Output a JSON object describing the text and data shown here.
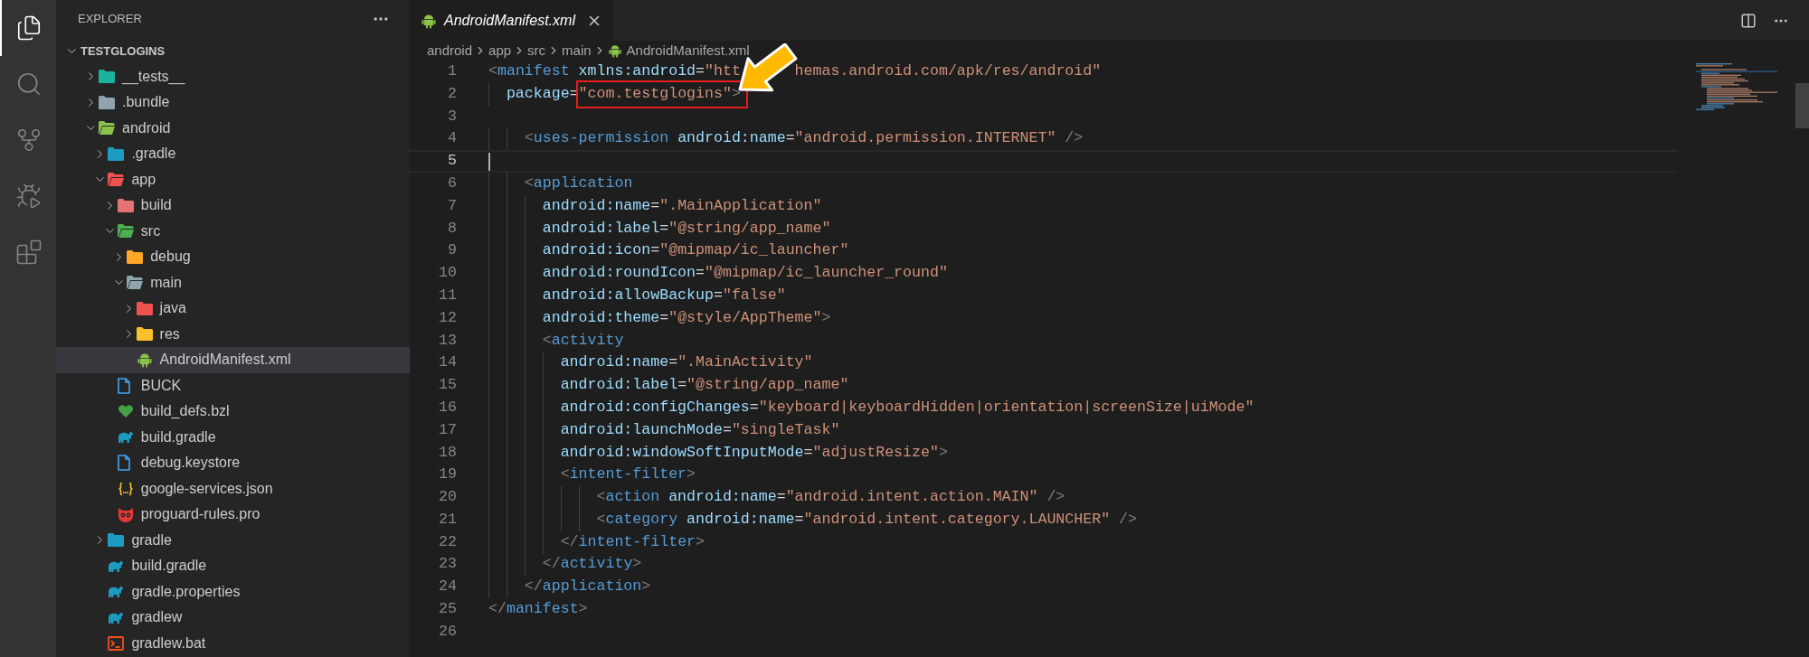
{
  "activity_bar": [
    {
      "kind": "files",
      "selected": true
    },
    {
      "kind": "search",
      "selected": false
    },
    {
      "kind": "source-control",
      "selected": false
    },
    {
      "kind": "run-debug",
      "selected": false
    },
    {
      "kind": "extensions",
      "selected": false
    }
  ],
  "explorer": {
    "title": "EXPLORER",
    "root": {
      "name": "TESTGLOGINS",
      "expanded": true,
      "children": [
        {
          "name": "__tests__",
          "kind": "folder-tests",
          "expanded": false,
          "selected": false
        },
        {
          "name": ".bundle",
          "kind": "folder",
          "expanded": false,
          "selected": false
        },
        {
          "name": "android",
          "kind": "folder-android",
          "expanded": true,
          "selected": false,
          "children": [
            {
              "name": ".gradle",
              "kind": "folder-gradle",
              "expanded": false,
              "selected": false
            },
            {
              "name": "app",
              "kind": "folder-app",
              "expanded": true,
              "selected": false,
              "children": [
                {
                  "name": "build",
                  "kind": "folder-build",
                  "expanded": false,
                  "selected": false
                },
                {
                  "name": "src",
                  "kind": "folder-src",
                  "expanded": true,
                  "selected": false,
                  "children": [
                    {
                      "name": "debug",
                      "kind": "folder-debug",
                      "expanded": false,
                      "selected": false
                    },
                    {
                      "name": "main",
                      "kind": "folder",
                      "expanded": true,
                      "selected": false,
                      "children": [
                        {
                          "name": "java",
                          "kind": "folder-java",
                          "expanded": false,
                          "selected": false
                        },
                        {
                          "name": "res",
                          "kind": "folder-res",
                          "expanded": false,
                          "selected": false
                        },
                        {
                          "name": "AndroidManifest.xml",
                          "kind": "android",
                          "selected": true
                        }
                      ]
                    }
                  ]
                },
                {
                  "name": "BUCK",
                  "kind": "file",
                  "selected": false
                },
                {
                  "name": "build_defs.bzl",
                  "kind": "heart",
                  "selected": false
                },
                {
                  "name": "build.gradle",
                  "kind": "elephant",
                  "selected": false
                },
                {
                  "name": "debug.keystore",
                  "kind": "file",
                  "selected": false
                },
                {
                  "name": "google-services.json",
                  "kind": "json",
                  "selected": false
                },
                {
                  "name": "proguard-rules.pro",
                  "kind": "owl",
                  "selected": false
                }
              ]
            },
            {
              "name": "gradle",
              "kind": "folder-gradle",
              "expanded": false,
              "selected": false
            },
            {
              "name": "build.gradle",
              "kind": "elephant",
              "selected": false
            },
            {
              "name": "gradle.properties",
              "kind": "elephant",
              "selected": false
            },
            {
              "name": "gradlew",
              "kind": "elephant",
              "selected": false
            },
            {
              "name": "gradlew.bat",
              "kind": "terminal",
              "selected": false
            }
          ]
        }
      ]
    }
  },
  "tabs": [
    {
      "label": "AndroidManifest.xml",
      "selected": true,
      "preview": true
    }
  ],
  "breadcrumbs": [
    {
      "label": "android",
      "kind": "folder"
    },
    {
      "label": "app",
      "kind": "folder"
    },
    {
      "label": "src",
      "kind": "folder"
    },
    {
      "label": "main",
      "kind": "folder"
    },
    {
      "label": "AndroidManifest.xml",
      "kind": "android"
    }
  ],
  "code": {
    "lines": [
      {
        "number": "1",
        "current": false,
        "parts": [
          {
            "boxed": false,
            "tokens": [
              {
                "kind": "bracket",
                "text": "<"
              },
              {
                "kind": "tag",
                "text": "manifest"
              },
              {
                "kind": "attr",
                "text": " xmlns:android"
              },
              {
                "kind": "plain",
                "text": "="
              },
              {
                "kind": "string",
                "text": "\"htt"
              }
            ]
          },
          {
            "boxed": false,
            "tokens": [
              {
                "kind": "string",
                "text": "hemas.android.com/apk/res/android\""
              }
            ]
          }
        ]
      },
      {
        "number": "2",
        "current": false,
        "parts": [
          {
            "boxed": false,
            "tokens": [
              {
                "kind": "attr",
                "text": "  package"
              },
              {
                "kind": "plain",
                "text": "="
              }
            ]
          },
          {
            "boxed": true,
            "tokens": [
              {
                "kind": "string",
                "text": "\"com.testglogins\""
              },
              {
                "kind": "bracket",
                "text": ">"
              }
            ]
          }
        ]
      },
      {
        "number": "3",
        "current": false
      },
      {
        "number": "4",
        "current": false,
        "parts": [
          {
            "boxed": false,
            "tokens": [
              {
                "kind": "bracket",
                "text": "    <"
              },
              {
                "kind": "tag",
                "text": "uses-permission"
              },
              {
                "kind": "attr",
                "text": " android:name"
              },
              {
                "kind": "plain",
                "text": "="
              },
              {
                "kind": "string",
                "text": "\"android.permission.INTERNET\""
              },
              {
                "kind": "bracket",
                "text": " />"
              }
            ]
          }
        ]
      },
      {
        "number": "5",
        "current": true
      },
      {
        "number": "6",
        "current": false,
        "parts": [
          {
            "boxed": false,
            "tokens": [
              {
                "kind": "bracket",
                "text": "    <"
              },
              {
                "kind": "tag",
                "text": "application"
              }
            ]
          }
        ]
      },
      {
        "number": "7",
        "current": false,
        "parts": [
          {
            "boxed": false,
            "tokens": [
              {
                "kind": "attr",
                "text": "      android:name"
              },
              {
                "kind": "plain",
                "text": "="
              },
              {
                "kind": "string",
                "text": "\".MainApplication\""
              }
            ]
          }
        ]
      },
      {
        "number": "8",
        "current": false,
        "parts": [
          {
            "boxed": false,
            "tokens": [
              {
                "kind": "attr",
                "text": "      android:label"
              },
              {
                "kind": "plain",
                "text": "="
              },
              {
                "kind": "string",
                "text": "\"@string/app_name\""
              }
            ]
          }
        ]
      },
      {
        "number": "9",
        "current": false,
        "parts": [
          {
            "boxed": false,
            "tokens": [
              {
                "kind": "attr",
                "text": "      android:icon"
              },
              {
                "kind": "plain",
                "text": "="
              },
              {
                "kind": "string",
                "text": "\"@mipmap/ic_launcher\""
              }
            ]
          }
        ]
      },
      {
        "number": "10",
        "current": false,
        "parts": [
          {
            "boxed": false,
            "tokens": [
              {
                "kind": "attr",
                "text": "      android:roundIcon"
              },
              {
                "kind": "plain",
                "text": "="
              },
              {
                "kind": "string",
                "text": "\"@mipmap/ic_launcher_round\""
              }
            ]
          }
        ]
      },
      {
        "number": "11",
        "current": false,
        "parts": [
          {
            "boxed": false,
            "tokens": [
              {
                "kind": "attr",
                "text": "      android:allowBackup"
              },
              {
                "kind": "plain",
                "text": "="
              },
              {
                "kind": "string",
                "text": "\"false\""
              }
            ]
          }
        ]
      },
      {
        "number": "12",
        "current": false,
        "parts": [
          {
            "boxed": false,
            "tokens": [
              {
                "kind": "attr",
                "text": "      android:theme"
              },
              {
                "kind": "plain",
                "text": "="
              },
              {
                "kind": "string",
                "text": "\"@style/AppTheme\""
              },
              {
                "kind": "bracket",
                "text": ">"
              }
            ]
          }
        ]
      },
      {
        "number": "13",
        "current": false,
        "parts": [
          {
            "boxed": false,
            "tokens": [
              {
                "kind": "bracket",
                "text": "      <"
              },
              {
                "kind": "tag",
                "text": "activity"
              }
            ]
          }
        ]
      },
      {
        "number": "14",
        "current": false,
        "parts": [
          {
            "boxed": false,
            "tokens": [
              {
                "kind": "attr",
                "text": "        android:name"
              },
              {
                "kind": "plain",
                "text": "="
              },
              {
                "kind": "string",
                "text": "\".MainActivity\""
              }
            ]
          }
        ]
      },
      {
        "number": "15",
        "current": false,
        "parts": [
          {
            "boxed": false,
            "tokens": [
              {
                "kind": "attr",
                "text": "        android:label"
              },
              {
                "kind": "plain",
                "text": "="
              },
              {
                "kind": "string",
                "text": "\"@string/app_name\""
              }
            ]
          }
        ]
      },
      {
        "number": "16",
        "current": false,
        "parts": [
          {
            "boxed": false,
            "tokens": [
              {
                "kind": "attr",
                "text": "        android:configChanges"
              },
              {
                "kind": "plain",
                "text": "="
              },
              {
                "kind": "string",
                "text": "\"keyboard|keyboardHidden|orientation|screenSize|uiMode\""
              }
            ]
          }
        ]
      },
      {
        "number": "17",
        "current": false,
        "parts": [
          {
            "boxed": false,
            "tokens": [
              {
                "kind": "attr",
                "text": "        android:launchMode"
              },
              {
                "kind": "plain",
                "text": "="
              },
              {
                "kind": "string",
                "text": "\"singleTask\""
              }
            ]
          }
        ]
      },
      {
        "number": "18",
        "current": false,
        "parts": [
          {
            "boxed": false,
            "tokens": [
              {
                "kind": "attr",
                "text": "        android:windowSoftInputMode"
              },
              {
                "kind": "plain",
                "text": "="
              },
              {
                "kind": "string",
                "text": "\"adjustResize\""
              },
              {
                "kind": "bracket",
                "text": ">"
              }
            ]
          }
        ]
      },
      {
        "number": "19",
        "current": false,
        "parts": [
          {
            "boxed": false,
            "tokens": [
              {
                "kind": "bracket",
                "text": "        <"
              },
              {
                "kind": "tag",
                "text": "intent-filter"
              },
              {
                "kind": "bracket",
                "text": ">"
              }
            ]
          }
        ]
      },
      {
        "number": "20",
        "current": false,
        "parts": [
          {
            "boxed": false,
            "tokens": [
              {
                "kind": "bracket",
                "text": "            <"
              },
              {
                "kind": "tag",
                "text": "action"
              },
              {
                "kind": "attr",
                "text": " android:name"
              },
              {
                "kind": "plain",
                "text": "="
              },
              {
                "kind": "string",
                "text": "\"android.intent.action.MAIN\""
              },
              {
                "kind": "bracket",
                "text": " />"
              }
            ]
          }
        ]
      },
      {
        "number": "21",
        "current": false,
        "parts": [
          {
            "boxed": false,
            "tokens": [
              {
                "kind": "bracket",
                "text": "            <"
              },
              {
                "kind": "tag",
                "text": "category"
              },
              {
                "kind": "attr",
                "text": " android:name"
              },
              {
                "kind": "plain",
                "text": "="
              },
              {
                "kind": "string",
                "text": "\"android.intent.category.LAUNCHER\""
              },
              {
                "kind": "bracket",
                "text": " />"
              }
            ]
          }
        ]
      },
      {
        "number": "22",
        "current": false,
        "parts": [
          {
            "boxed": false,
            "tokens": [
              {
                "kind": "bracket",
                "text": "        </"
              },
              {
                "kind": "tag",
                "text": "intent-filter"
              },
              {
                "kind": "bracket",
                "text": ">"
              }
            ]
          }
        ]
      },
      {
        "number": "23",
        "current": false,
        "parts": [
          {
            "boxed": false,
            "tokens": [
              {
                "kind": "bracket",
                "text": "      </"
              },
              {
                "kind": "tag",
                "text": "activity"
              },
              {
                "kind": "bracket",
                "text": ">"
              }
            ]
          }
        ]
      },
      {
        "number": "24",
        "current": false,
        "parts": [
          {
            "boxed": false,
            "tokens": [
              {
                "kind": "bracket",
                "text": "    </"
              },
              {
                "kind": "tag",
                "text": "application"
              },
              {
                "kind": "bracket",
                "text": ">"
              }
            ]
          }
        ]
      },
      {
        "number": "25",
        "current": false,
        "parts": [
          {
            "boxed": false,
            "tokens": [
              {
                "kind": "bracket",
                "text": "</"
              },
              {
                "kind": "tag",
                "text": "manifest"
              },
              {
                "kind": "bracket",
                "text": ">"
              }
            ]
          }
        ]
      },
      {
        "number": "26",
        "current": false
      }
    ]
  }
}
